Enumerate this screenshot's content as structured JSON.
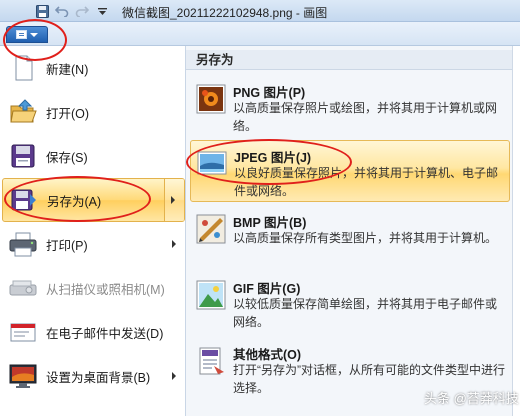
{
  "window": {
    "title": "微信截图_20211222102948.png - 画图"
  },
  "quick_access": {
    "save_icon": "floppy-icon",
    "undo_icon": "undo-icon",
    "redo_icon": "redo-icon",
    "customize_icon": "dropdown-icon"
  },
  "left_menu": {
    "items": [
      {
        "label": "新建(N)",
        "icon": "new-document-icon",
        "has_submenu": false,
        "enabled": true
      },
      {
        "label": "打开(O)",
        "icon": "open-folder-icon",
        "has_submenu": false,
        "enabled": true
      },
      {
        "label": "保存(S)",
        "icon": "floppy-icon",
        "has_submenu": false,
        "enabled": true
      },
      {
        "label": "另存为(A)",
        "icon": "save-as-icon",
        "has_submenu": true,
        "enabled": true,
        "selected": true
      },
      {
        "label": "打印(P)",
        "icon": "printer-icon",
        "has_submenu": true,
        "enabled": true
      },
      {
        "label": "从扫描仪或照相机(M)",
        "icon": "scanner-icon",
        "has_submenu": false,
        "enabled": false
      },
      {
        "label": "在电子邮件中发送(D)",
        "icon": "email-icon",
        "has_submenu": false,
        "enabled": true
      },
      {
        "label": "设置为桌面背景(B)",
        "icon": "desktop-icon",
        "has_submenu": true,
        "enabled": true
      }
    ]
  },
  "submenu": {
    "header": "另存为",
    "items": [
      {
        "name": "PNG 图片(P)",
        "desc": "以高质量保存照片或绘图，并将其用于计算机或网络。",
        "icon": "png-image-icon"
      },
      {
        "name": "JPEG 图片(J)",
        "desc": "以良好质量保存照片，并将其用于计算机、电子邮件或网络。",
        "icon": "jpeg-image-icon",
        "hovered": true
      },
      {
        "name": "BMP 图片(B)",
        "desc": "以高质量保存所有类型图片，并将其用于计算机。",
        "icon": "bmp-image-icon"
      },
      {
        "name": "GIF 图片(G)",
        "desc": "以较低质量保存简单绘图，并将其用于电子邮件或网络。",
        "icon": "gif-image-icon"
      },
      {
        "name": "其他格式(O)",
        "desc": "打开“另存为”对话框，从所有可能的文件类型中进行选择。",
        "icon": "other-format-icon"
      }
    ]
  },
  "watermark": "头条 @苔莽科技",
  "colors": {
    "highlight": "#ffd978",
    "annotation": "#e0201b"
  }
}
